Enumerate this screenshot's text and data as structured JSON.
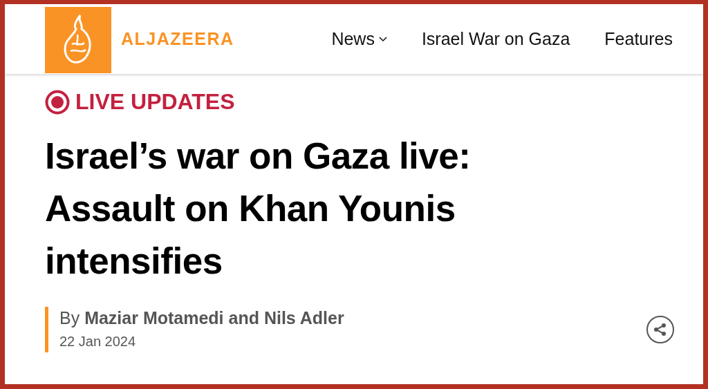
{
  "header": {
    "logo_text": "ALJAZEERA",
    "nav": [
      {
        "label": "News",
        "dropdown": true
      },
      {
        "label": "Israel War on Gaza",
        "dropdown": false
      },
      {
        "label": "Features",
        "dropdown": false
      }
    ]
  },
  "article": {
    "badge": "LIVE UPDATES",
    "title": "Israel’s war on Gaza live: Assault on Khan Younis intensifies",
    "byline": "By **Maziar Motamedi and Nils Adler**",
    "date": "22 Jan 2024"
  }
}
